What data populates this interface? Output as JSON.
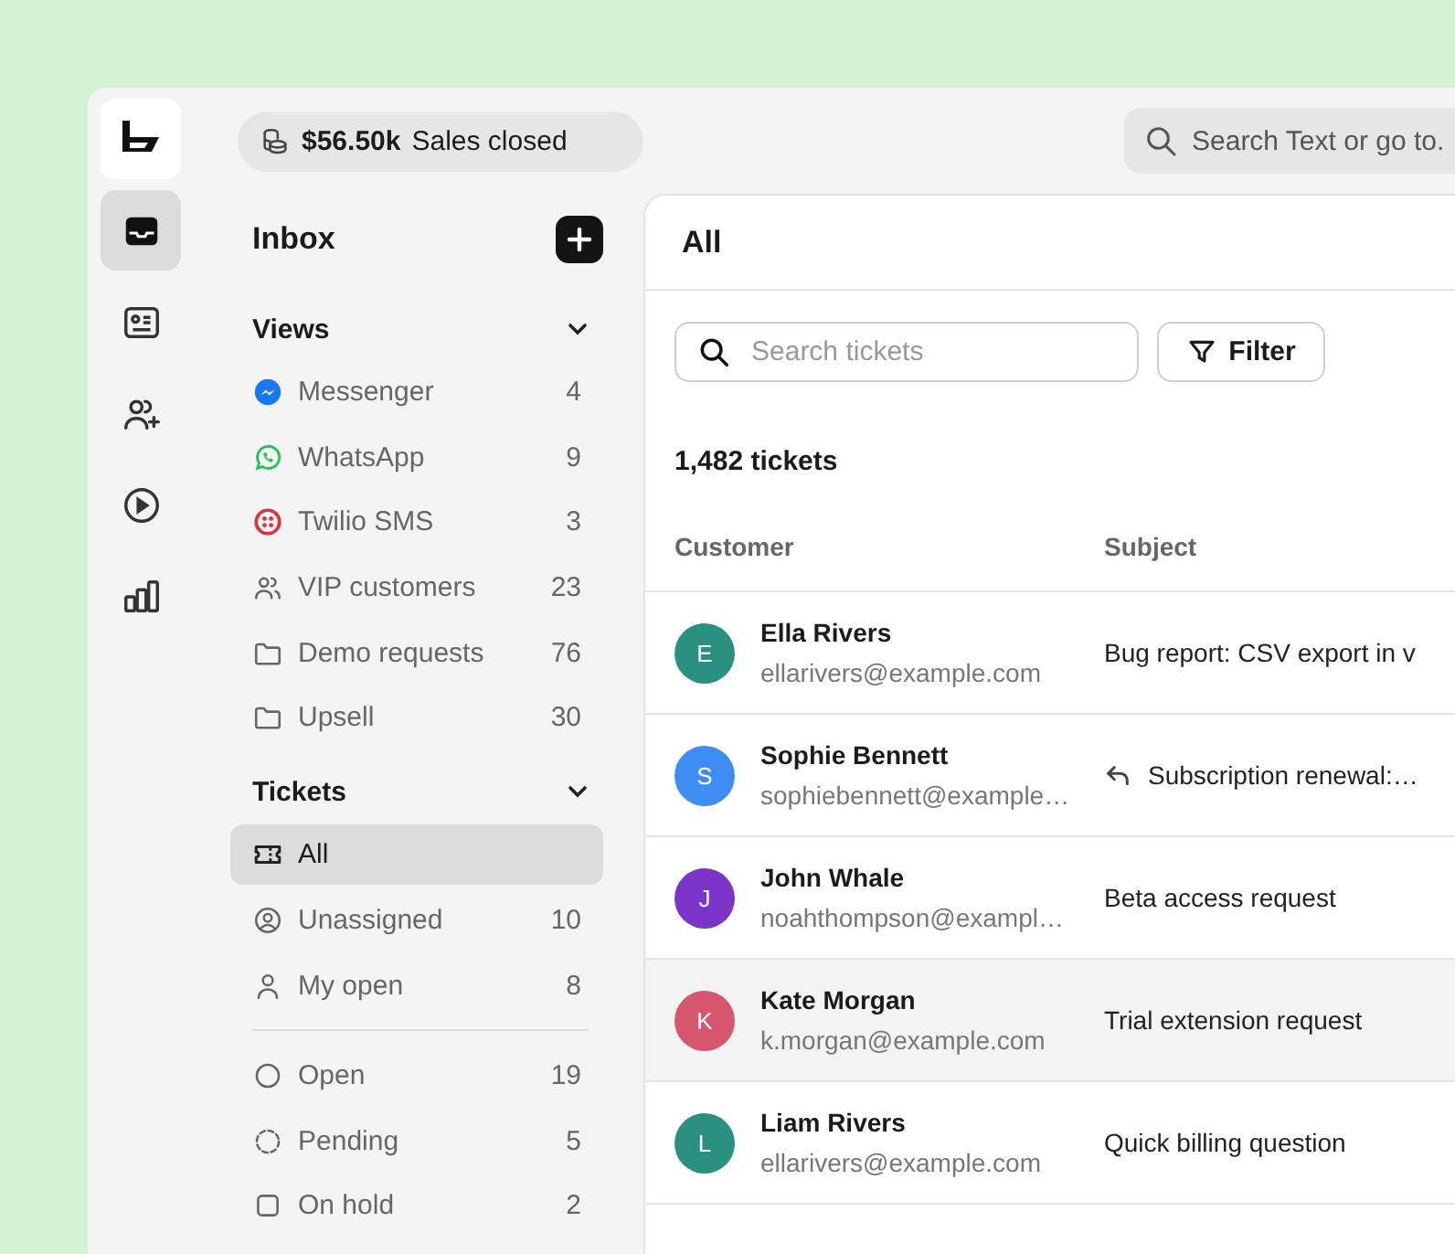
{
  "rail": [
    {
      "kind": "inbox",
      "selected": true
    },
    {
      "kind": "contact-card",
      "selected": false
    },
    {
      "kind": "users-plus",
      "selected": false
    },
    {
      "kind": "play",
      "selected": false
    },
    {
      "kind": "chart",
      "selected": false
    }
  ],
  "topbar": {
    "sales": {
      "amount": "$56.50k",
      "label": "Sales closed"
    },
    "search": {
      "placeholder": "Search Text or go to."
    }
  },
  "sidebar": {
    "title": "Inbox",
    "sections": [
      {
        "title": "Views",
        "expanded": true,
        "groups": [
          [
            {
              "kind": "messenger",
              "label": "Messenger",
              "count": "4",
              "selected": false
            },
            {
              "kind": "whatsapp",
              "label": "WhatsApp",
              "count": "9",
              "selected": false
            },
            {
              "kind": "twilio",
              "label": "Twilio SMS",
              "count": "3",
              "selected": false
            },
            {
              "kind": "users",
              "label": "VIP customers",
              "count": "23",
              "selected": false
            },
            {
              "kind": "folder",
              "label": "Demo requests",
              "count": "76",
              "selected": false
            },
            {
              "kind": "folder",
              "label": "Upsell",
              "count": "30",
              "selected": false
            }
          ]
        ]
      },
      {
        "title": "Tickets",
        "expanded": true,
        "groups": [
          [
            {
              "kind": "ticket",
              "label": "All",
              "selected": true
            },
            {
              "kind": "user-circle",
              "label": "Unassigned",
              "count": "10",
              "selected": false
            },
            {
              "kind": "user",
              "label": "My open",
              "count": "8",
              "selected": false
            }
          ],
          [
            {
              "kind": "circle",
              "label": "Open",
              "count": "19",
              "selected": false
            },
            {
              "kind": "circle-dashed",
              "label": "Pending",
              "count": "5",
              "selected": false
            },
            {
              "kind": "square",
              "label": "On hold",
              "count": "2",
              "selected": false
            }
          ]
        ]
      }
    ]
  },
  "main": {
    "title": "All",
    "search": {
      "placeholder": "Search tickets"
    },
    "filter": "Filter",
    "count": "1,482 tickets",
    "table": {
      "columns": [
        "Customer",
        "Subject"
      ],
      "rows": [
        {
          "initial": "E",
          "color": "#2a9180",
          "name": "Ella Rivers",
          "email": "ellarivers@example.com",
          "subject": "Bug report: CSV export in v",
          "replied": false,
          "selected": false
        },
        {
          "initial": "S",
          "color": "#3d8df5",
          "name": "Sophie Bennett",
          "email": "sophiebennett@example…",
          "subject": "Subscription renewal:…",
          "replied": true,
          "selected": false
        },
        {
          "initial": "J",
          "color": "#7a35c8",
          "name": "John Whale",
          "email": "noahthompson@exampl…",
          "subject": "Beta access request",
          "replied": false,
          "selected": false
        },
        {
          "initial": "K",
          "color": "#d6566e",
          "name": "Kate Morgan",
          "email": "k.morgan@example.com",
          "subject": "Trial extension request",
          "replied": false,
          "selected": true
        },
        {
          "initial": "L",
          "color": "#2a9180",
          "name": "Liam Rivers",
          "email": "ellarivers@example.com",
          "subject": "Quick billing question",
          "replied": false,
          "selected": false
        }
      ]
    }
  }
}
